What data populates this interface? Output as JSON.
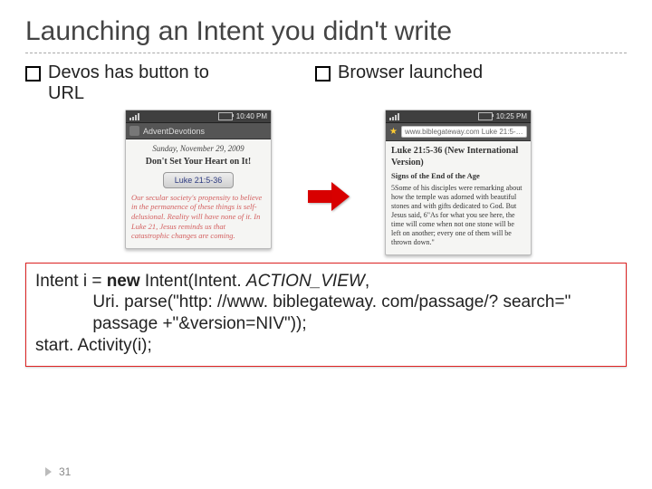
{
  "title": "Launching an Intent you didn't write",
  "bullets": {
    "left": {
      "line1": "Devos",
      "line2": "has button to",
      "line3": "URL"
    },
    "right": {
      "line1": "Browser",
      "line2": "launched"
    }
  },
  "phones": {
    "left": {
      "statusbar_time": "10:40 PM",
      "app_title": "AdventDevotions",
      "date": "Sunday, November 29, 2009",
      "headline": "Don't Set Your Heart on It!",
      "button_label": "Luke 21:5-36",
      "body": "Our secular society's propensity to believe in the permanence of these things is self-delusional. Reality will have none of it. In Luke 21, Jesus reminds us that catastrophic changes are coming."
    },
    "right": {
      "statusbar_time": "10:25 PM",
      "url": "www.biblegateway.com   Luke 21:5-36 - …",
      "passage_title": "Luke 21:5-36 (New International Version)",
      "section_heading": "Signs of the End of the Age",
      "verse": "5Some of his disciples were remarking about how the temple was adorned with beautiful stones and with gifts dedicated to God. But Jesus said, 6\"As for what you see here, the time will come when not one stone will be left on another; every one of them will be thrown down.\""
    }
  },
  "arrow": {
    "icon": "arrow-right"
  },
  "code": {
    "l1a": "Intent i = ",
    "l1_new": "new",
    "l1b": " Intent(Intent. ",
    "l1_ital": "ACTION_VIEW",
    "l1c": ",",
    "l2": "            Uri. parse(\"http: //www. biblegateway. com/passage/? search=\"",
    "l3": "            passage +\"&version=NIV\"));",
    "l4": "start. Activity(i);"
  },
  "page_number": "31"
}
